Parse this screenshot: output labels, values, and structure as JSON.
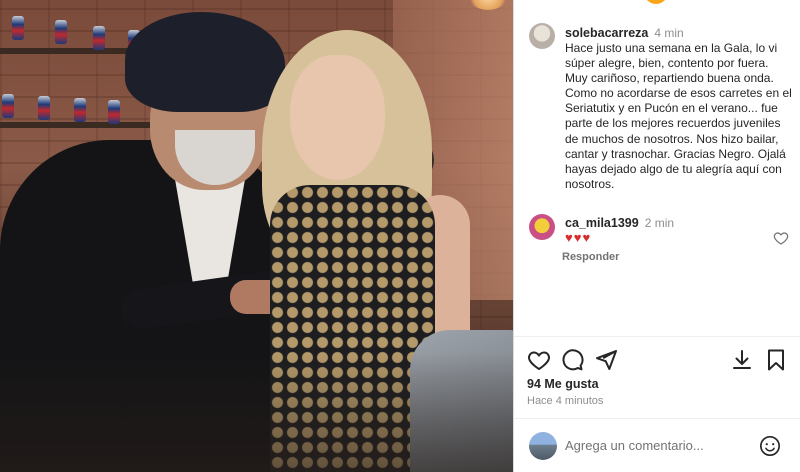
{
  "post": {
    "photo_alt": "Foto de la publicación"
  },
  "caption": {
    "username": "solebacarreza",
    "time": "4 min",
    "text": "Hace justo una semana en la Gala, lo vi súper alegre, bien, contento por fuera. Muy cariñoso, repartiendo buena onda. Como no acordarse de esos carretes en el Seriatutix y en Pucón en el verano... fue parte de los mejores recuerdos juveniles de muchos de nosotros. Nos hizo bailar, cantar y trasnochar. Gracias Negro. Ojalá hayas dejado algo de tu alegría aquí con nosotros."
  },
  "reply": {
    "username": "ca_mila1399",
    "time": "2 min",
    "text": "♥♥♥",
    "reply_label": "Responder"
  },
  "actions": {
    "icons": [
      "heart-icon",
      "comment-icon",
      "share-icon",
      "download-icon",
      "bookmark-icon"
    ]
  },
  "stats": {
    "likes": "94 Me gusta",
    "posted": "Hace 4 minutos"
  },
  "comment_box": {
    "placeholder": "Agrega un comentario..."
  },
  "colors": {
    "text": "#262626",
    "muted": "#8e8e8e",
    "heart_red": "#d62d2d",
    "border": "#dbdbdb"
  }
}
